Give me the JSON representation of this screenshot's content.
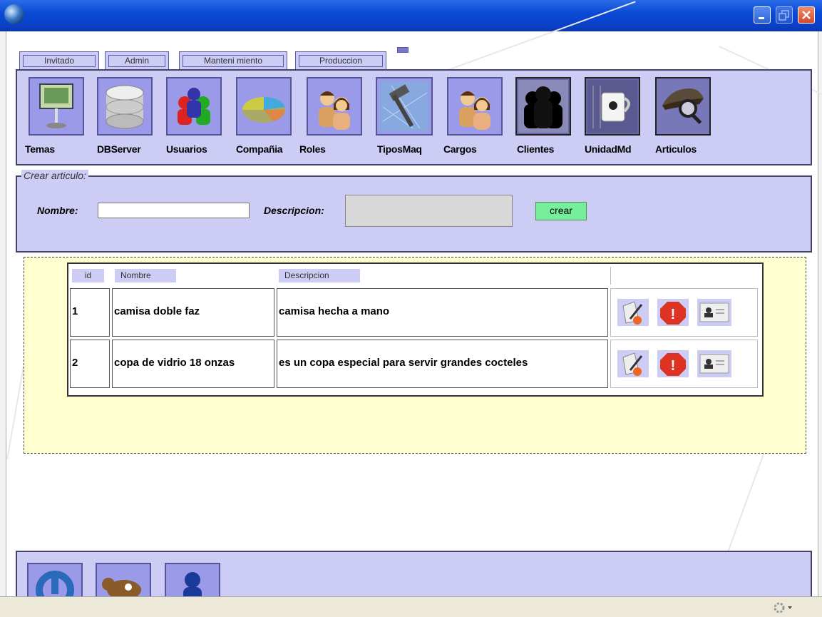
{
  "tabs": [
    {
      "label": "Invitado"
    },
    {
      "label": "Admin"
    },
    {
      "label": "Manteni miento"
    },
    {
      "label": "Produccion"
    }
  ],
  "toolbar": {
    "items": [
      {
        "label": "Temas",
        "icon": "presentation-icon"
      },
      {
        "label": "DBServer",
        "icon": "database-icon"
      },
      {
        "label": "Usuarios",
        "icon": "users-icon"
      },
      {
        "label": "Compañia",
        "icon": "company-chart-icon"
      },
      {
        "label": "Roles",
        "icon": "people-icon"
      },
      {
        "label": "TiposMaq",
        "icon": "hammer-icon"
      },
      {
        "label": "Cargos",
        "icon": "people-icon"
      },
      {
        "label": "Clientes",
        "icon": "silhouettes-icon"
      },
      {
        "label": "UnidadMd",
        "icon": "coffee-cup-icon"
      },
      {
        "label": "Articulos",
        "icon": "detective-magnifier-icon"
      }
    ]
  },
  "form": {
    "legend": "Crear articulo:",
    "nombre_label": "Nombre:",
    "nombre_value": "",
    "descripcion_label": "Descripcion:",
    "descripcion_value": "",
    "crear_label": "crear"
  },
  "table": {
    "headers": [
      "id",
      "Nombre",
      "Descripcion"
    ],
    "rows": [
      {
        "id": "1",
        "nombre": "camisa doble faz",
        "descripcion": "camisa hecha a mano"
      },
      {
        "id": "2",
        "nombre": "copa de vidrio 18 onzas",
        "descripcion": "es un copa especial para servir grandes cocteles"
      }
    ],
    "actions": [
      "edit-icon",
      "delete-warning-icon",
      "user-card-icon"
    ]
  },
  "bottom": {
    "buttons": [
      "power-icon",
      "cow-icon",
      "user-tools-icon"
    ]
  },
  "colors": {
    "panel": "#ccccf5",
    "grid_bg": "#ffffd0",
    "crear_bg": "#77ee99",
    "titlebar": "#0a4ad6"
  }
}
